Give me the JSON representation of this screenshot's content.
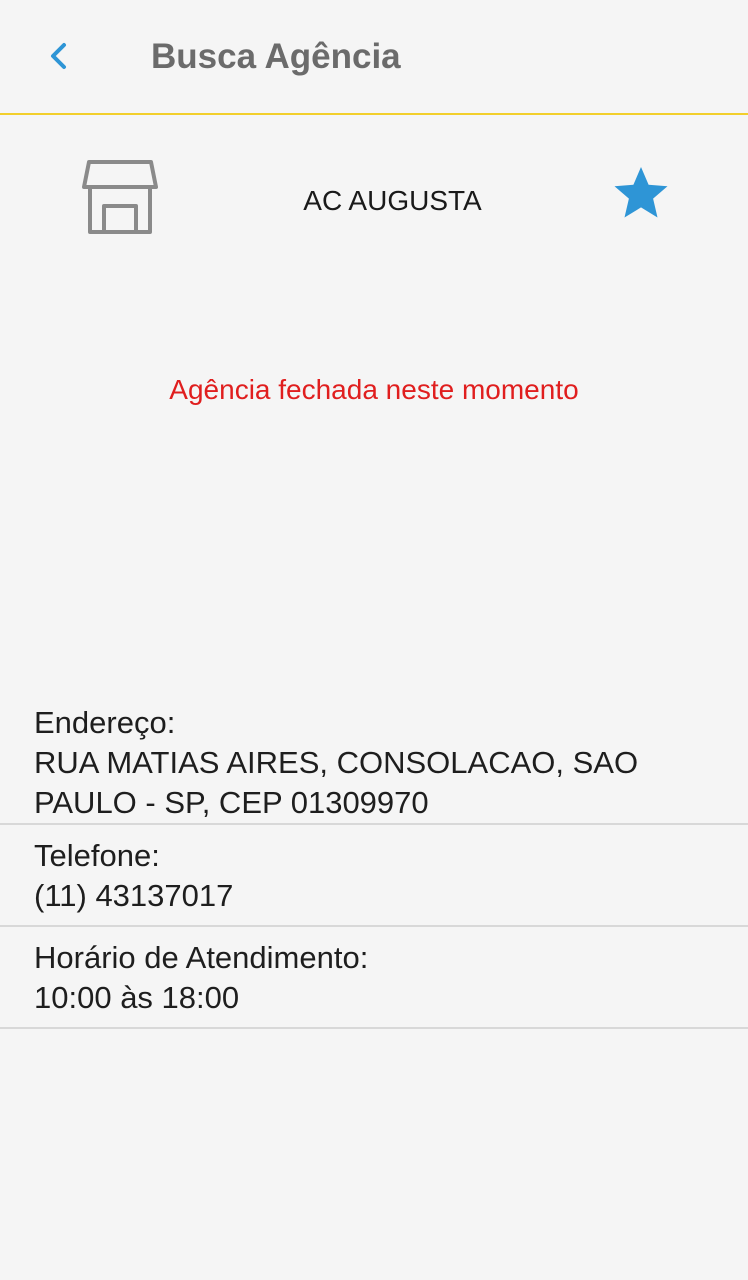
{
  "header": {
    "title": "Busca Agência",
    "back_icon": "chevron-left-icon"
  },
  "agency": {
    "icon": "store-icon",
    "name": "AC AUGUSTA",
    "favorite_icon": "star-icon",
    "status": "Agência fechada neste momento"
  },
  "details": {
    "address_label": "Endereço:",
    "address_value": "RUA MATIAS AIRES, CONSOLACAO, SAO PAULO - SP, CEP 01309970",
    "phone_label": "Telefone:",
    "phone_value": "(11) 43137017",
    "hours_label": "Horário de Atendimento:",
    "hours_value": "10:00 às 18:00"
  },
  "colors": {
    "accent_blue": "#2e95d6",
    "header_divider": "#f2cf2c",
    "status_red": "#e01e1e",
    "title_gray": "#6b6b6b",
    "icon_gray": "#8a8a8a"
  }
}
